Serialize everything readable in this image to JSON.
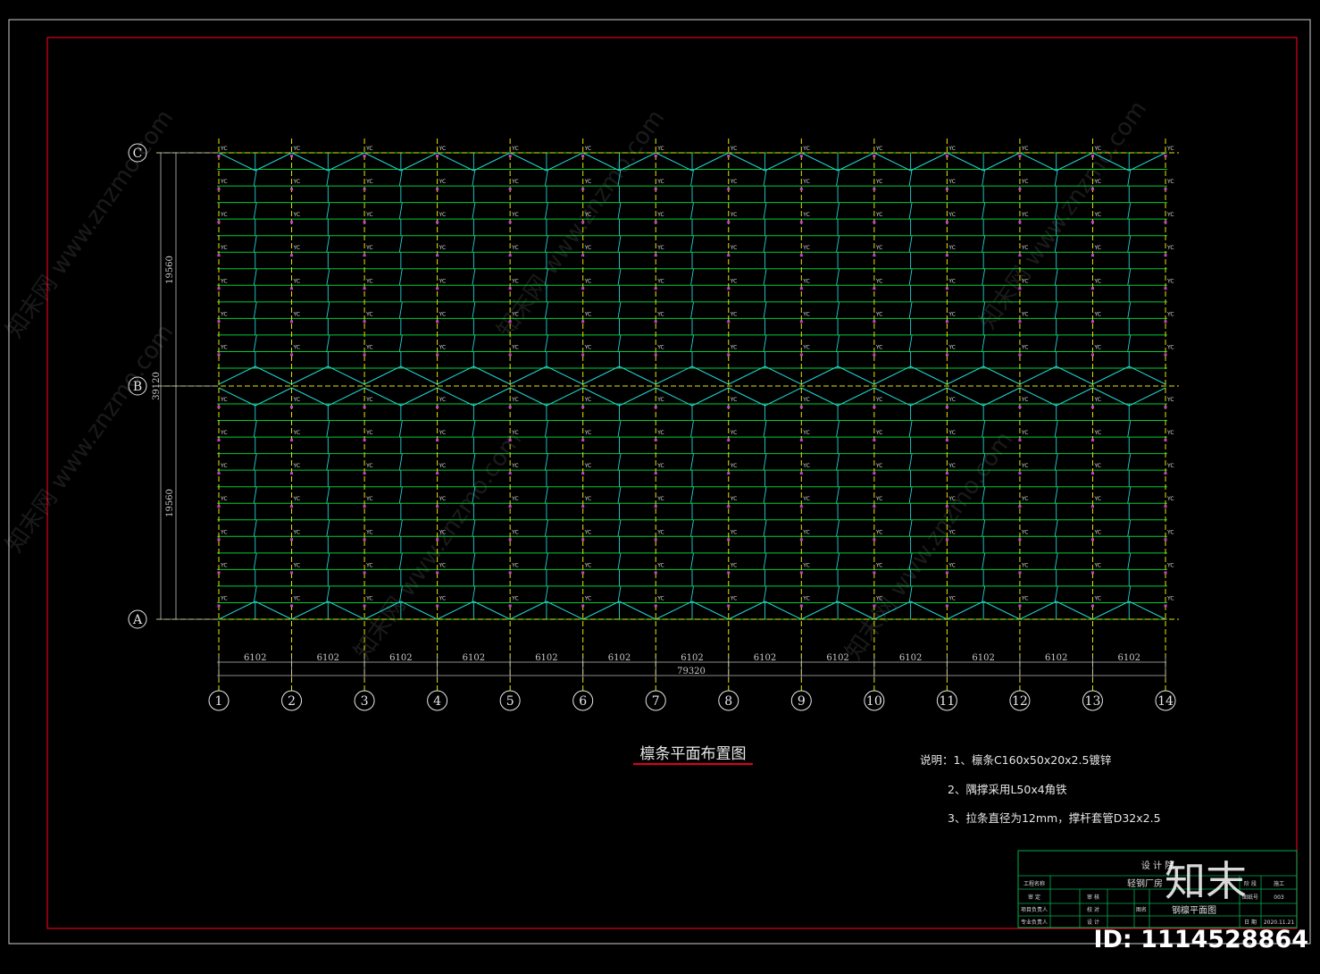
{
  "drawing": {
    "title": "檩条平面布置图",
    "grid_rows": [
      "C",
      "B",
      "A"
    ],
    "grid_cols": [
      "1",
      "2",
      "3",
      "4",
      "5",
      "6",
      "7",
      "8",
      "9",
      "10",
      "11",
      "12",
      "13",
      "14"
    ],
    "bay_dimension": "6102",
    "total_length": "79320",
    "row_dimension": "19560",
    "total_width": "39120",
    "purlin_tag": "YC",
    "notes": [
      "说明：1、檩条C160x50x20x2.5镀锌",
      "2、隅撑采用L50x4角铁",
      "3、拉条直径为12mm，撑杆套管D32x2.5"
    ]
  },
  "title_block": {
    "institute": "设  计  院",
    "project_label": "工程名称",
    "project_value": "轻钢厂房",
    "stage_label": "阶 段",
    "stage_value": "施工",
    "drawing_no_label": "图纸号",
    "drawing_no_value": "003",
    "drawing_name": "钢檩平面图",
    "date_label": "日 期",
    "date_value": "2020.11.21",
    "row_labels": [
      "审  定",
      "项目负责人",
      "专业负责人"
    ],
    "row_labels2": [
      "审 核",
      "校 对",
      "设 计"
    ],
    "col_label": "图名"
  },
  "watermark": {
    "text": "知末网 www.znzmo.com",
    "logo": "知末",
    "id": "ID: 1114528864"
  },
  "colors": {
    "frame_red": "#e0001a",
    "grid_yellow": "#e6e600",
    "purlin_green": "#00cc33",
    "brace_cyan": "#22d4d4",
    "tag_magenta": "#d23cd2",
    "titleblock_green": "#00b050"
  }
}
